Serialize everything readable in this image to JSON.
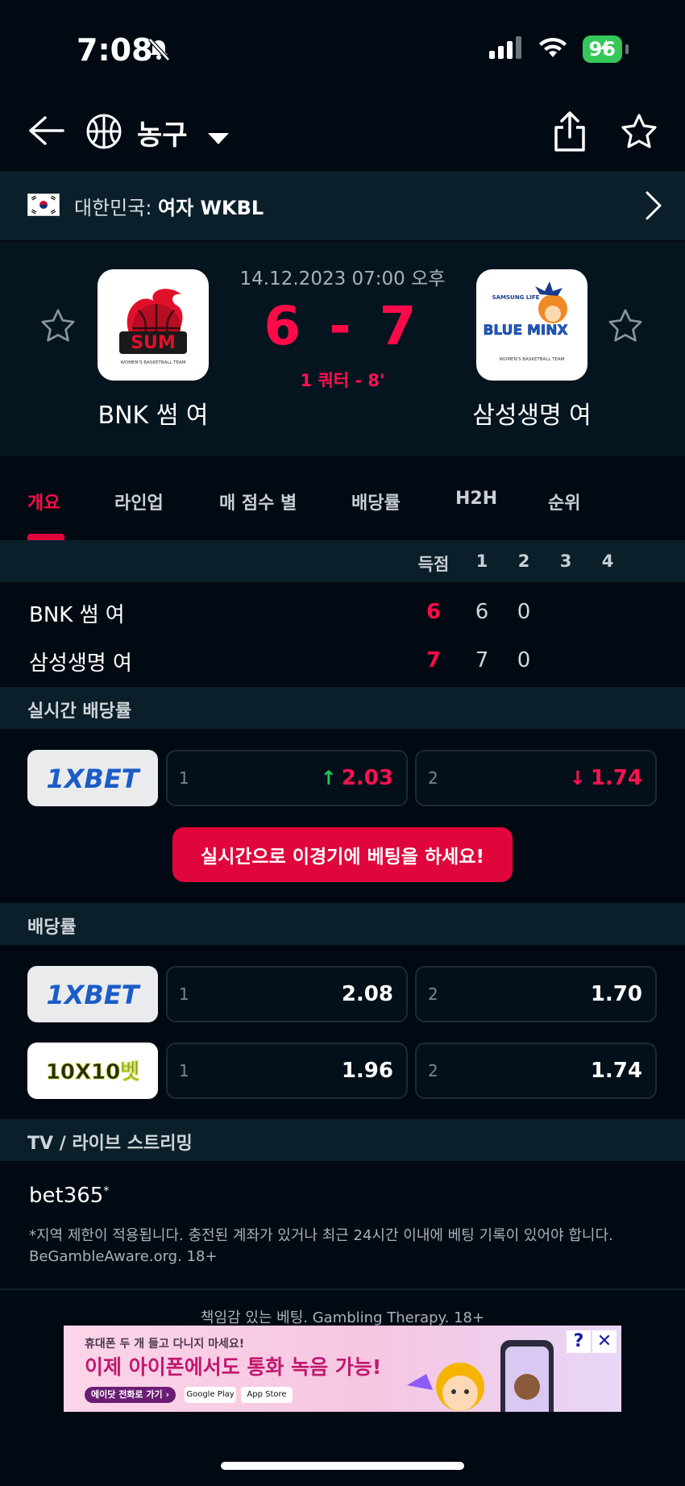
{
  "status_bar": {
    "time": "7:08",
    "battery": "96"
  },
  "nav": {
    "sport": "농구"
  },
  "league": {
    "country": "대한민국:",
    "name": "여자 WKBL"
  },
  "match": {
    "datetime": "14.12.2023 07:00 오후",
    "score": "6 - 7",
    "period": "1 쿼터 - 8'",
    "home": {
      "name": "BNK 썸 여",
      "logo_text": "SUM",
      "logo_sub": "WOMEN'S BASKETBALL TEAM"
    },
    "away": {
      "name": "삼성생명 여",
      "logo_text": "BLUE MINX",
      "logo_sub": "WOMEN'S BASKETBALL TEAM",
      "logo_top": "SAMSUNG LIFE"
    }
  },
  "tabs": [
    "개요",
    "라인업",
    "매 점수 별",
    "배당률",
    "H2H",
    "순위"
  ],
  "scoreboard": {
    "headers": [
      "득점",
      "1",
      "2",
      "3",
      "4"
    ],
    "rows": [
      {
        "team": "BNK 썸 여",
        "total": "6",
        "q1": "6",
        "q2": "0"
      },
      {
        "team": "삼성생명 여",
        "total": "7",
        "q1": "7",
        "q2": "0"
      }
    ]
  },
  "live_odds": {
    "title": "실시간 배당률",
    "bookmaker": "1XBET",
    "opt1": {
      "label": "1",
      "value": "2.03"
    },
    "opt2": {
      "label": "2",
      "value": "1.74"
    },
    "cta": "실시간으로 이경기에 베팅을 하세요!"
  },
  "odds": {
    "title": "배당률",
    "rows": [
      {
        "bookmaker": "1XBET",
        "o1_label": "1",
        "o1": "2.08",
        "o2_label": "2",
        "o2": "1.70"
      },
      {
        "bookmaker": "10X10벳",
        "o1_label": "1",
        "o1": "1.96",
        "o2_label": "2",
        "o2": "1.74"
      }
    ]
  },
  "tv": {
    "title": "TV / 라이브 스트리밍",
    "provider": "bet365",
    "mark": "*",
    "disclaimer": "*지역 제한이 적용됩니다. 충전된 계좌가 있거나 최근 24시간 이내에 베팅 기록이 있어야 합니다. BeGambleAware.org. 18+"
  },
  "responsible": "책임감 있는 베팅. Gambling Therapy. 18+",
  "ad": {
    "small": "휴대폰 두 개 들고 다니지 마세요!",
    "big": "이제 아이폰에서도 통화 녹음 가능!",
    "pill": "에이닷 전화로 가기",
    "store1": "Google Play",
    "store2": "App Store",
    "info": "?",
    "close": "✕"
  },
  "colors": {
    "accent": "#e0063c",
    "score": "#ff0a48",
    "up": "#1ec85a",
    "down": "#ff1050"
  }
}
